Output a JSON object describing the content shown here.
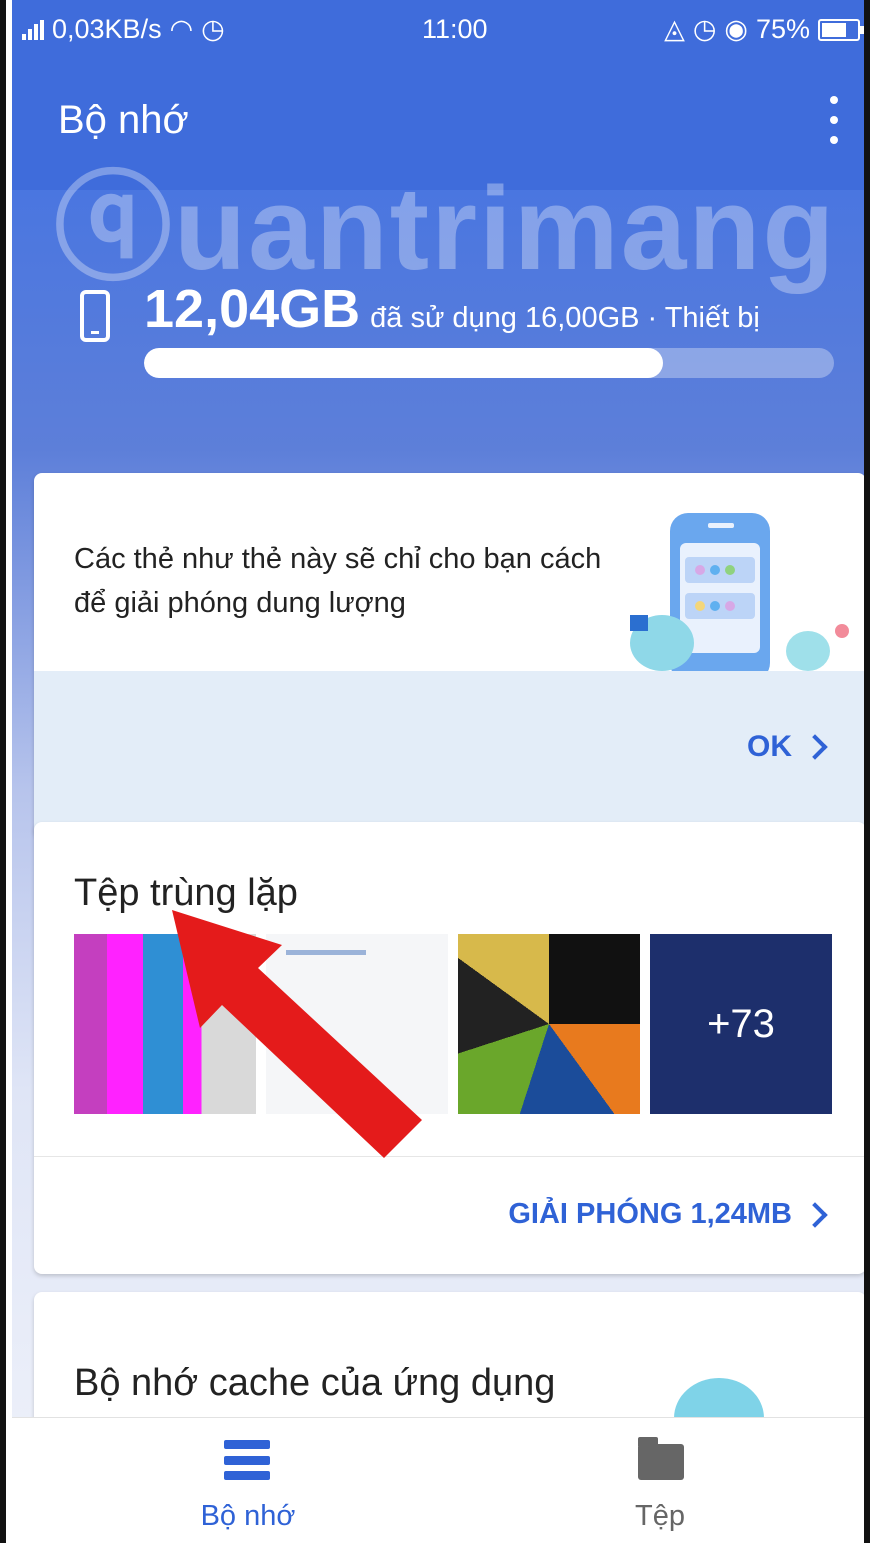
{
  "status_bar": {
    "left_text": "0,03KB/s",
    "time": "11:00",
    "battery": "75%"
  },
  "appbar": {
    "title": "Bộ nhớ"
  },
  "watermark": "uantrimang",
  "storage": {
    "used": "12,04GB",
    "detail": "đã sử dụng 16,00GB · Thiết bị",
    "used_fraction": 0.752
  },
  "tip_card": {
    "text": "Các thẻ như thẻ này sẽ chỉ cho bạn cách để giải phóng dung lượng",
    "ok_label": "OK"
  },
  "duplicate_card": {
    "title": "Tệp trùng lặp",
    "more_count": "+73",
    "action_label": "GIẢI PHÓNG 1,24MB"
  },
  "cache_card": {
    "title": "Bộ nhớ cache của ứng dụng"
  },
  "bottom_nav": {
    "items": [
      {
        "label": "Bộ nhớ",
        "icon": "storage-icon",
        "active": true
      },
      {
        "label": "Tệp",
        "icon": "folder-icon",
        "active": false
      }
    ]
  },
  "colors": {
    "primary_blue": "#3f6cdb",
    "accent_text": "#2f62d6",
    "annotation_red": "#e41b1b"
  }
}
